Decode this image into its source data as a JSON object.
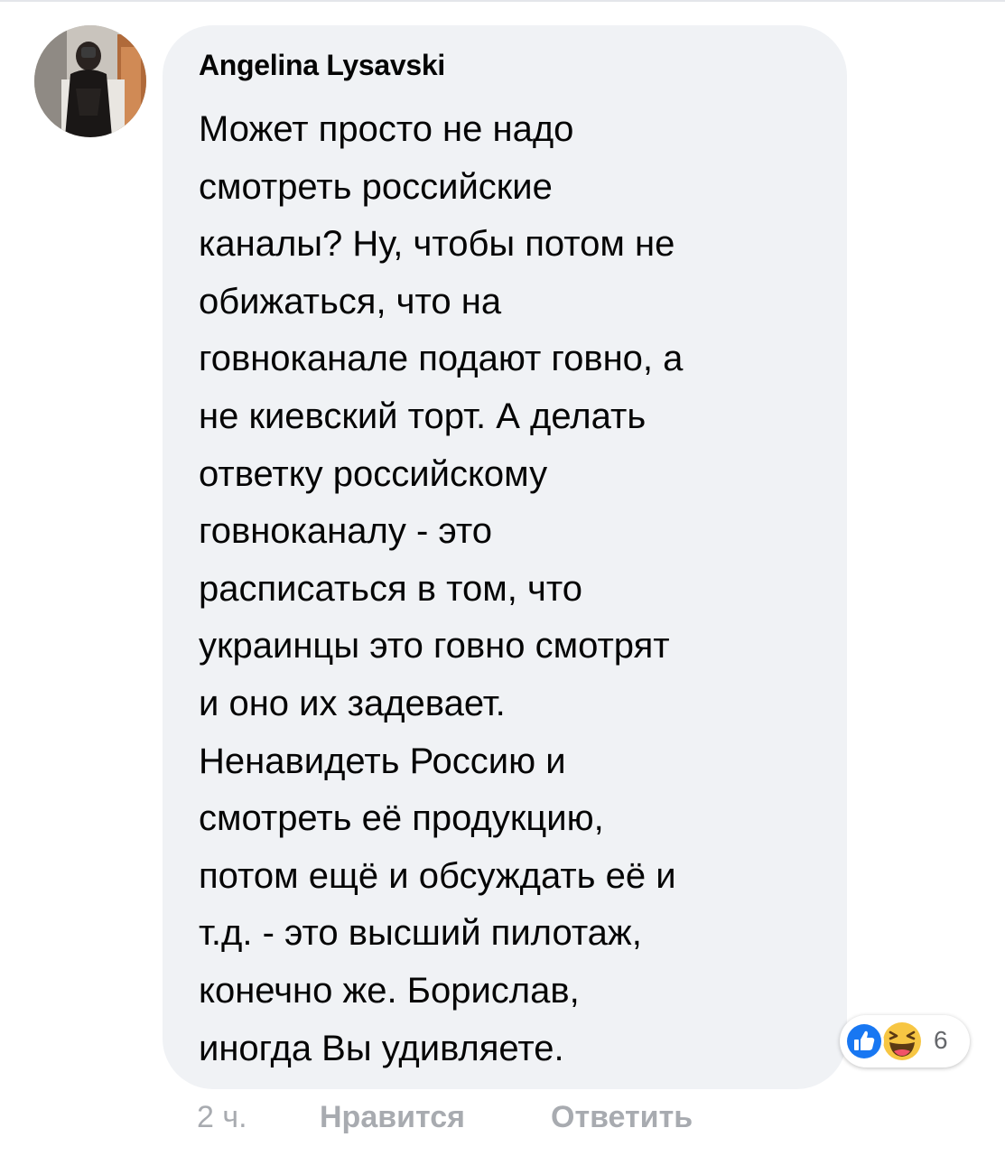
{
  "comment": {
    "author": "Angelina Lysavski",
    "text_lines": [
      "Может просто не надо",
      "смотреть российские",
      "каналы? Ну, чтобы потом не",
      "обижаться, что на",
      "говноканале подают говно, а",
      "не киевский торт. А делать",
      "ответку российскому",
      "говноканалу - это",
      "расписаться в том, что",
      "украинцы это говно смотрят",
      "и оно их задевает.",
      "Ненавидеть Россию и",
      "смотреть её продукцию,",
      "потом ещё и обсуждать её и",
      "т.д. - это высший пилотаж,",
      "конечно же. Борислав,",
      "иногда Вы удивляете."
    ],
    "time": "2 ч.",
    "like_label": "Нравится",
    "reply_label": "Ответить"
  },
  "reactions": {
    "icons": [
      "like-icon",
      "haha-icon"
    ],
    "count": "6"
  },
  "colors": {
    "bubble": "#f0f2f5",
    "text": "#050505",
    "muted": "#65676b",
    "action": "#a8abb0",
    "like_blue": "#1877f2",
    "haha_yellow": "#f7c643"
  }
}
